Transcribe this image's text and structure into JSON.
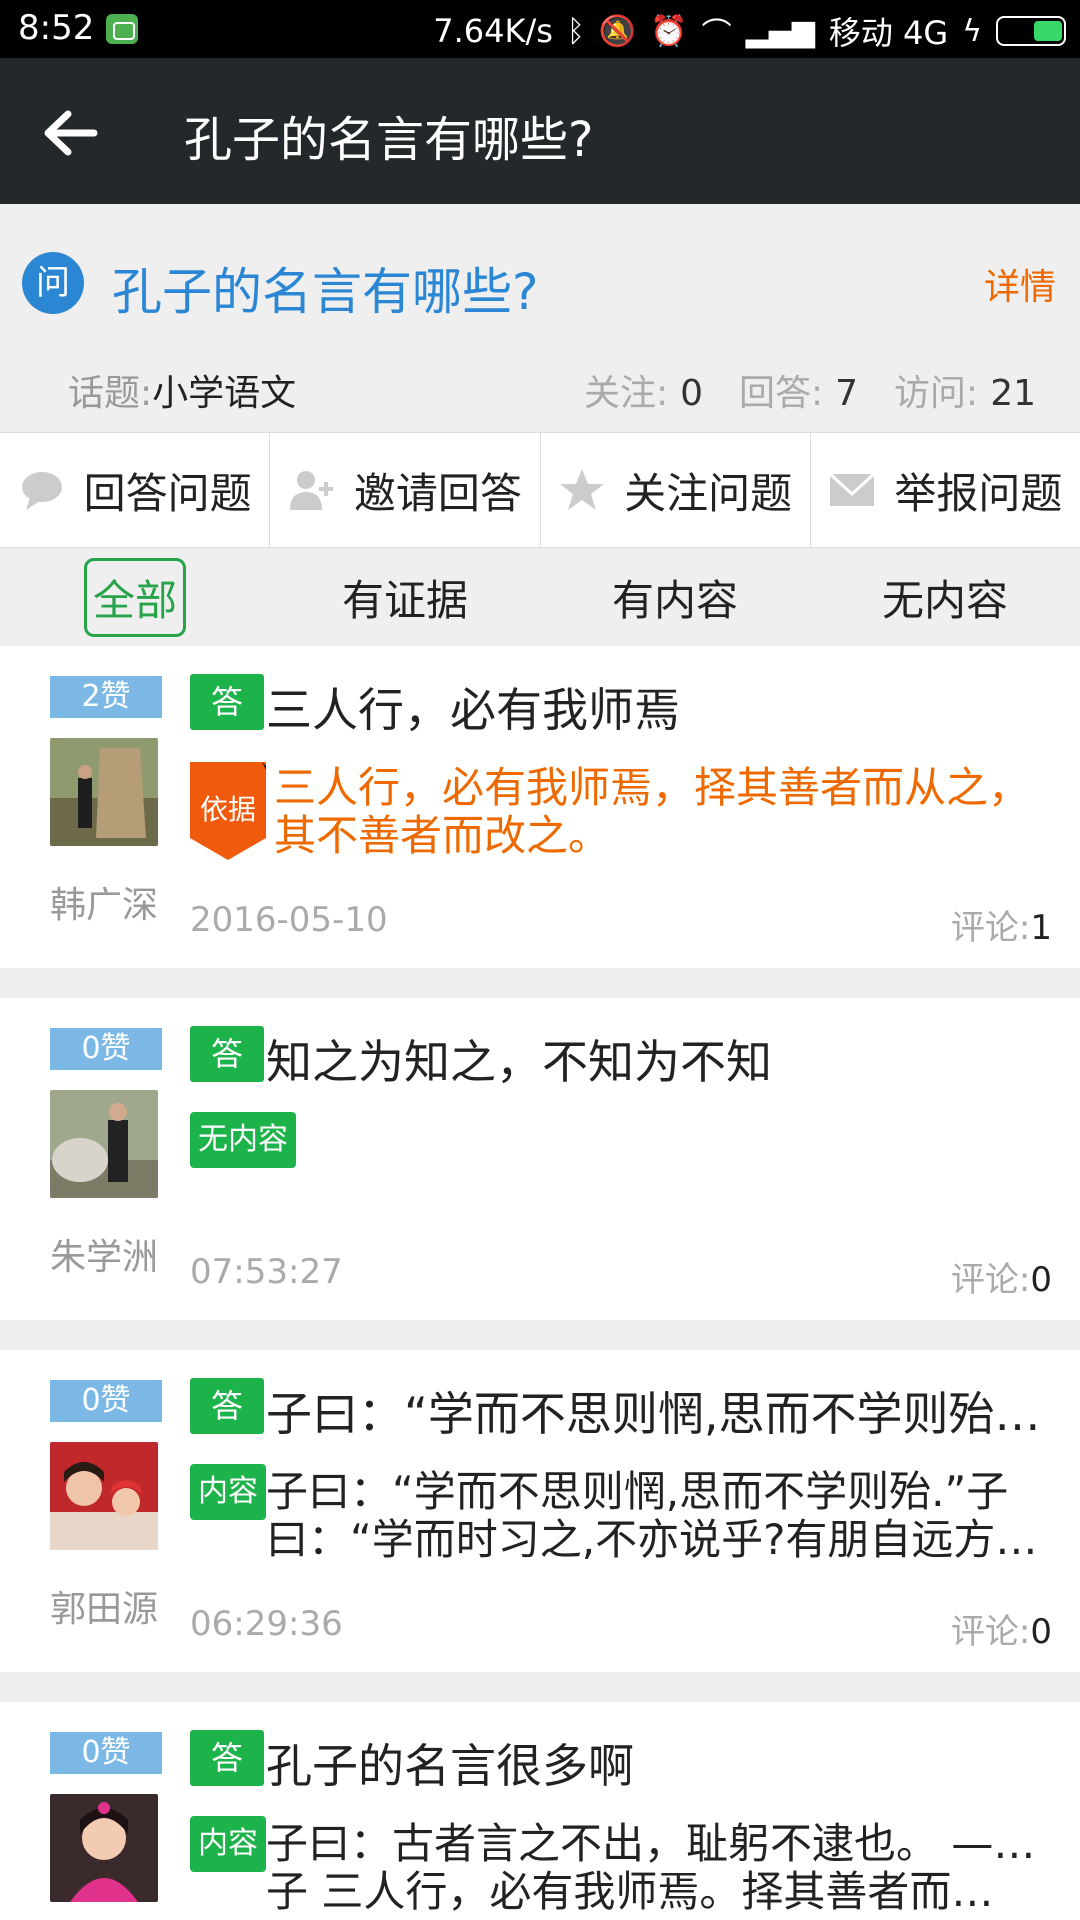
{
  "status_bar": {
    "time": "8:52",
    "net_speed": "7.64K/s",
    "carrier": "移动 4G",
    "icons": [
      "bluetooth-icon",
      "mute-icon",
      "alarm-icon",
      "wifi-icon",
      "signal-icon",
      "charging-icon",
      "battery-icon"
    ]
  },
  "header": {
    "title": "孔子的名言有哪些?"
  },
  "question": {
    "badge": "问",
    "title": "孔子的名言有哪些?",
    "detail_link": "详情",
    "topic_label": "话题:",
    "topic": "小学语文",
    "follow_label": "关注:",
    "follow_count": "0",
    "answer_label": "回答:",
    "answer_count": "7",
    "visit_label": "访问:",
    "visit_count": "21"
  },
  "actions": [
    {
      "label": "回答问题",
      "icon": "comment-icon"
    },
    {
      "label": "邀请回答",
      "icon": "add-user-icon"
    },
    {
      "label": "关注问题",
      "icon": "star-icon"
    },
    {
      "label": "举报问题",
      "icon": "envelope-icon"
    }
  ],
  "filters": [
    {
      "label": "全部",
      "active": true
    },
    {
      "label": "有证据"
    },
    {
      "label": "有内容"
    },
    {
      "label": "无内容"
    }
  ],
  "answers": [
    {
      "likes": "2赞",
      "user": "韩广深",
      "answer_tag": "答",
      "title": "三人行，必有我师焉",
      "body_tag": "依据",
      "body": "三人行，必有我师焉，择其善者而从之，其不善者而改之。",
      "date": "2016-05-10",
      "comment_label": "评论:",
      "comment_count": "1"
    },
    {
      "likes": "0赞",
      "user": "朱学洲",
      "answer_tag": "答",
      "title": "知之为知之，不知为不知",
      "body_tag": "无内容",
      "date": "07:53:27",
      "comment_label": "评论:",
      "comment_count": "0"
    },
    {
      "likes": "0赞",
      "user": "郭田源",
      "answer_tag": "答",
      "title": "子曰：“学而不思则惘,思而不学则殆.”子曰：“学而时习之,不亦说乎?有朋自远方来,…",
      "body_tag": "内容",
      "body_line1": "子曰：“学而不思则惘,思而不学则殆.”子",
      "body_line2": "曰：“学而时习之,不亦说乎?有朋自远方来,…",
      "date": "06:29:36",
      "comment_label": "评论:",
      "comment_count": "0"
    },
    {
      "likes": "0赞",
      "answer_tag": "答",
      "title": "孔子的名言很多啊",
      "body_tag": "内容",
      "body_line1": "子曰：古者言之不出，耻躬不逮也。 —— 孔",
      "body_line2": "子 三人行，必有我师焉。择其善者而…"
    }
  ]
}
